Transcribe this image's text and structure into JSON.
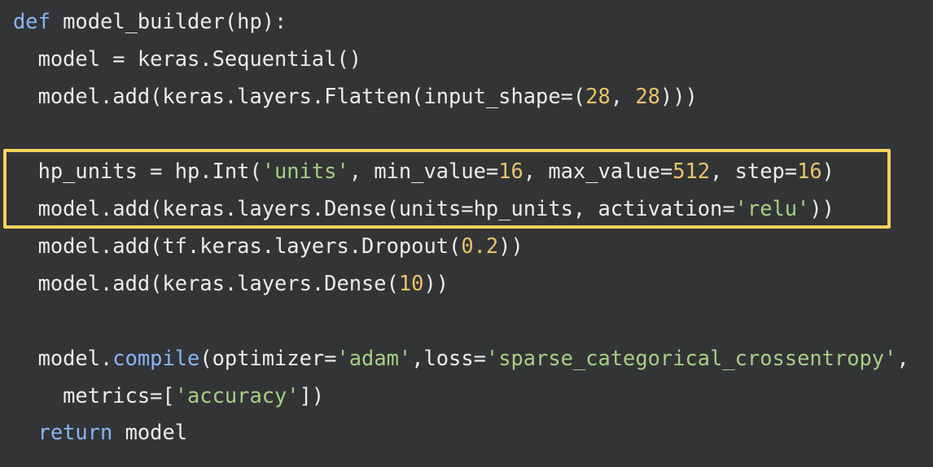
{
  "code": {
    "lines": [
      {
        "segments": [
          {
            "t": "def",
            "c": "kw"
          },
          {
            "t": " model_builder(hp):",
            "c": "plain"
          }
        ]
      },
      {
        "segments": [
          {
            "t": "  model = keras.Sequential()",
            "c": "plain"
          }
        ]
      },
      {
        "segments": [
          {
            "t": "  model.add(keras.layers.Flatten(input_shape=(",
            "c": "plain"
          },
          {
            "t": "28",
            "c": "num"
          },
          {
            "t": ", ",
            "c": "plain"
          },
          {
            "t": "28",
            "c": "num"
          },
          {
            "t": ")))",
            "c": "plain"
          }
        ]
      },
      {
        "segments": []
      },
      {
        "segments": [
          {
            "t": "  hp_units = hp.Int(",
            "c": "plain"
          },
          {
            "t": "'units'",
            "c": "str"
          },
          {
            "t": ", min_value=",
            "c": "plain"
          },
          {
            "t": "16",
            "c": "num"
          },
          {
            "t": ", max_value=",
            "c": "plain"
          },
          {
            "t": "512",
            "c": "num"
          },
          {
            "t": ", step=",
            "c": "plain"
          },
          {
            "t": "16",
            "c": "num"
          },
          {
            "t": ")",
            "c": "plain"
          }
        ]
      },
      {
        "segments": [
          {
            "t": "  model.add(keras.layers.Dense(units=hp_units, activation=",
            "c": "plain"
          },
          {
            "t": "'relu'",
            "c": "str"
          },
          {
            "t": "))",
            "c": "plain"
          }
        ]
      },
      {
        "segments": [
          {
            "t": "  model.add(tf.keras.layers.Dropout(",
            "c": "plain"
          },
          {
            "t": "0.2",
            "c": "num"
          },
          {
            "t": "))",
            "c": "plain"
          }
        ]
      },
      {
        "segments": [
          {
            "t": "  model.add(keras.layers.Dense(",
            "c": "plain"
          },
          {
            "t": "10",
            "c": "num"
          },
          {
            "t": "))",
            "c": "plain"
          }
        ]
      },
      {
        "segments": []
      },
      {
        "segments": [
          {
            "t": "  model.",
            "c": "plain"
          },
          {
            "t": "compile",
            "c": "kw"
          },
          {
            "t": "(optimizer=",
            "c": "plain"
          },
          {
            "t": "'adam'",
            "c": "str"
          },
          {
            "t": ",loss=",
            "c": "plain"
          },
          {
            "t": "'sparse_categorical_crossentropy'",
            "c": "str"
          },
          {
            "t": ",",
            "c": "plain"
          }
        ]
      },
      {
        "segments": [
          {
            "t": "    metrics=[",
            "c": "plain"
          },
          {
            "t": "'accuracy'",
            "c": "str"
          },
          {
            "t": "])",
            "c": "plain"
          }
        ]
      },
      {
        "segments": [
          {
            "t": "  ",
            "c": "plain"
          },
          {
            "t": "return",
            "c": "kw"
          },
          {
            "t": " model",
            "c": "plain"
          }
        ]
      }
    ]
  },
  "colors": {
    "background": "#333436",
    "keyword": "#8ab4f8",
    "string": "#a6cf85",
    "number": "#e9c46a",
    "text": "#ececec",
    "highlight_border": "#f4d35e"
  }
}
